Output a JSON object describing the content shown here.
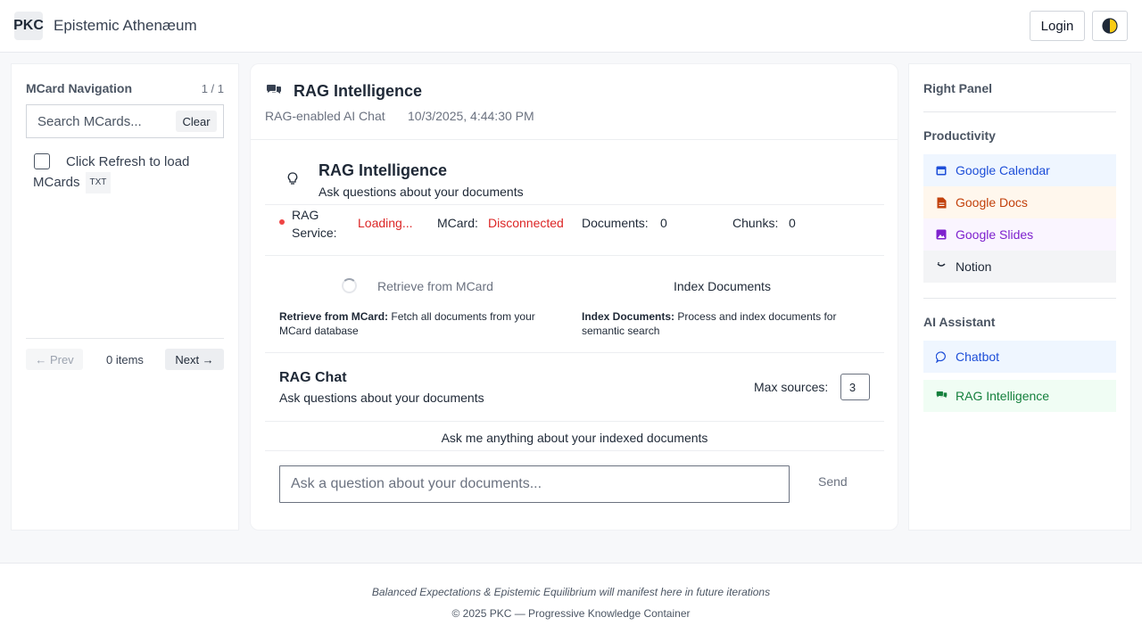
{
  "header": {
    "logo": "PKC",
    "brand": "Epistemic Athenæum",
    "login_label": "Login",
    "theme_icon": "half-moon-icon"
  },
  "left_panel": {
    "title": "MCard Navigation",
    "count": "1 / 1",
    "search_placeholder": "Search MCards...",
    "clear_label": "Clear",
    "empty_message": "Click Refresh to load MCards",
    "empty_badge": "TXT",
    "prev_label": "← Prev",
    "items_count": "0 items",
    "next_label": "Next →"
  },
  "main": {
    "title": "RAG Intelligence",
    "subtitle": "RAG-enabled AI Chat",
    "timestamp": "10/3/2025, 4:44:30 PM",
    "rag_title": "RAG Intelligence",
    "rag_subtitle": "Ask questions about your documents",
    "status": {
      "service_label": "RAG Service:",
      "service_value": "Loading...",
      "mcard_label": "MCard:",
      "mcard_value": "Disconnected",
      "documents_label": "Documents:",
      "documents_value": "0",
      "chunks_label": "Chunks:",
      "chunks_value": "0"
    },
    "actions": {
      "retrieve_label": "Retrieve from MCard",
      "index_label": "Index Documents",
      "retrieve_desc_bold": "Retrieve from MCard:",
      "retrieve_desc": " Fetch all documents from your MCard database",
      "index_desc_bold": "Index Documents:",
      "index_desc": " Process and index documents for semantic search"
    },
    "chat": {
      "title": "RAG Chat",
      "subtitle": "Ask questions about your documents",
      "max_sources_label": "Max sources:",
      "max_sources_value": "3",
      "empty_message": "Ask me anything about your indexed documents",
      "input_placeholder": "Ask a question about your documents...",
      "send_label": "Send"
    }
  },
  "right_panel": {
    "title": "Right Panel",
    "productivity_title": "Productivity",
    "productivity": [
      {
        "label": "Google Calendar",
        "icon": "calendar-icon",
        "color": "#1d4ed8",
        "bg": "#eff6ff"
      },
      {
        "label": "Google Docs",
        "icon": "document-icon",
        "color": "#c2410c",
        "bg": "#fff7ed"
      },
      {
        "label": "Google Slides",
        "icon": "image-icon",
        "color": "#7e22ce",
        "bg": "#faf5ff"
      },
      {
        "label": "Notion",
        "icon": "notion-icon",
        "color": "#1f2937",
        "bg": "#f3f4f6"
      }
    ],
    "assistant_title": "AI Assistant",
    "assistant": [
      {
        "label": "Chatbot",
        "icon": "chat-bubble-icon",
        "color": "#1d4ed8",
        "bg": "#eff6ff"
      },
      {
        "label": "RAG Intelligence",
        "icon": "chat-bubbles-icon",
        "color": "#15803d",
        "bg": "#f0fdf4"
      }
    ]
  },
  "footer": {
    "tagline": "Balanced Expectations & Epistemic Equilibrium will manifest here in future iterations",
    "copyright": "© 2025 PKC — Progressive Knowledge Container"
  }
}
